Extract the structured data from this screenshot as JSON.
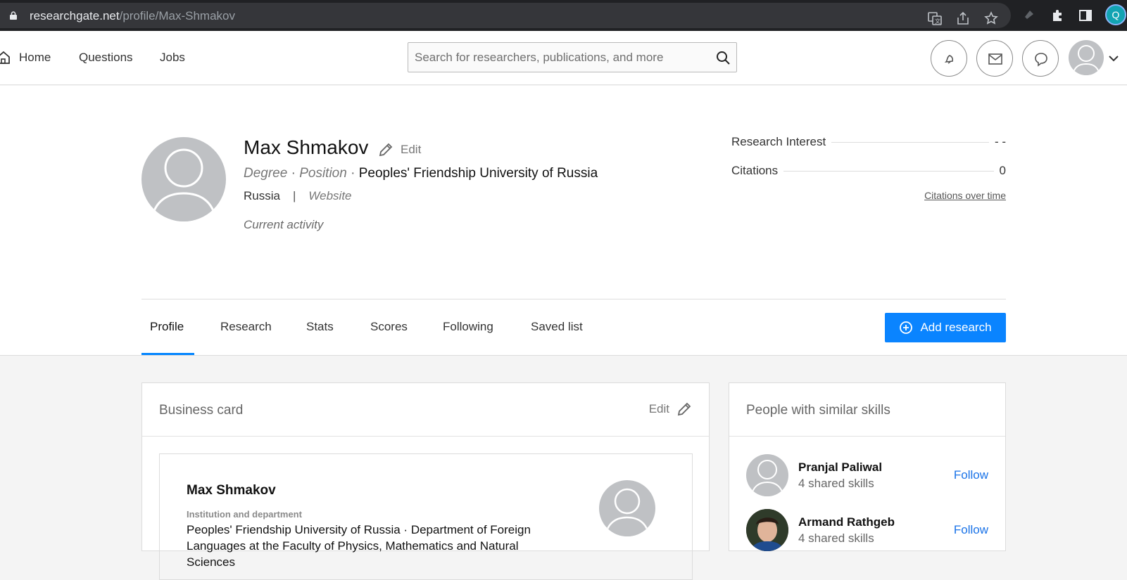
{
  "browser": {
    "url_host": "researchgate.net",
    "url_path": "/profile/Max-Shmakov",
    "profile_initial": "Q",
    "icons": [
      "lock-icon",
      "translate-icon",
      "share-icon",
      "star-icon",
      "extension-puzzle-icon",
      "side-panel-icon"
    ]
  },
  "nav": {
    "home": "Home",
    "questions": "Questions",
    "jobs": "Jobs",
    "search_placeholder": "Search for researchers, publications, and more"
  },
  "profile": {
    "name": "Max Shmakov",
    "edit": "Edit",
    "degree": "Degree",
    "position": "Position",
    "dot": "·",
    "institution": "Peoples' Friendship University of Russia",
    "country": "Russia",
    "sep": "|",
    "website": "Website",
    "current_activity": "Current activity"
  },
  "stats": {
    "research_interest_label": "Research Interest",
    "research_interest_value": "- -",
    "citations_label": "Citations",
    "citations_value": "0",
    "citations_over_time": "Citations over time"
  },
  "tabs": [
    "Profile",
    "Research",
    "Stats",
    "Scores",
    "Following",
    "Saved list"
  ],
  "active_tab": "Profile",
  "add_research": "Add research",
  "business_card": {
    "title": "Business card",
    "edit": "Edit",
    "name": "Max Shmakov",
    "inst_label": "Institution and department",
    "inst_text": "Peoples' Friendship University of Russia · Department of Foreign Languages at the Faculty of Physics, Mathematics and Natural Sciences"
  },
  "similar": {
    "title": "People with similar skills",
    "people": [
      {
        "name": "Pranjal Paliwal",
        "sub": "4 shared skills",
        "action": "Follow"
      },
      {
        "name": "Armand Rathgeb",
        "sub": "4 shared skills",
        "action": "Follow"
      }
    ]
  },
  "colors": {
    "accent": "#0a84ff",
    "link": "#1a73e8",
    "avatar_placeholder": "#bfc1c4"
  }
}
